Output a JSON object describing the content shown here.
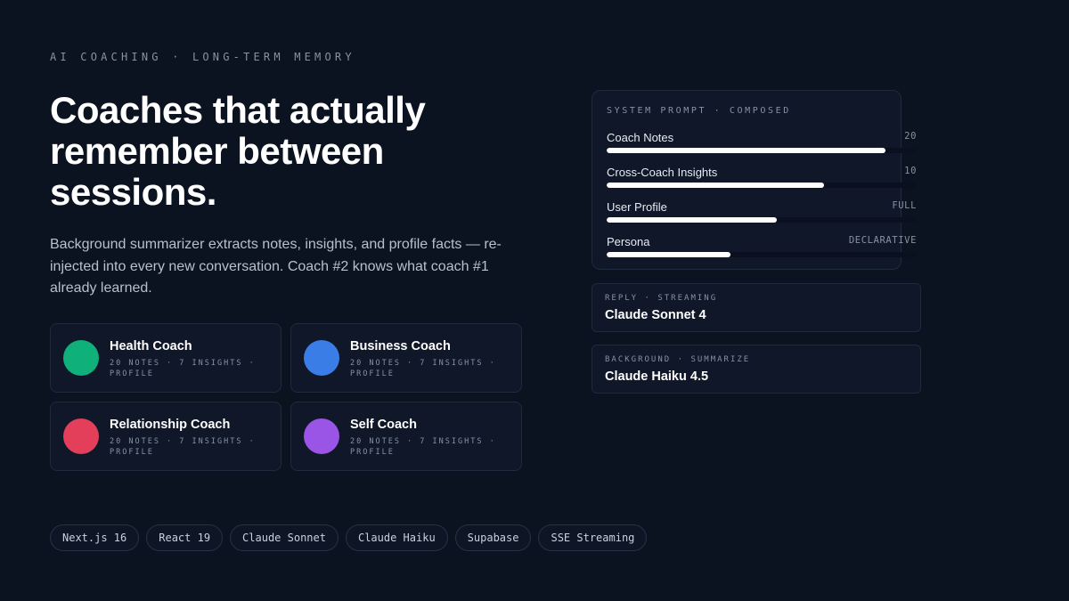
{
  "hero": {
    "eyebrow": "AI COACHING · LONG-TERM MEMORY",
    "headline": "Coaches that actually remember between sessions.",
    "subtitle": "Background summarizer extracts notes, insights, and profile facts — re-injected into every new conversation. Coach #2 knows what coach #1 already learned."
  },
  "coaches": [
    {
      "name": "Health Coach",
      "meta_line1": "20 NOTES · 7 INSIGHTS ·",
      "meta_line2": "PROFILE",
      "color": "#10b07a"
    },
    {
      "name": "Business Coach",
      "meta_line1": "20 NOTES · 7 INSIGHTS ·",
      "meta_line2": "PROFILE",
      "color": "#3b7de6"
    },
    {
      "name": "Relationship Coach",
      "meta_line1": "20 NOTES · 7 INSIGHTS ·",
      "meta_line2": "PROFILE",
      "color": "#e33e5a"
    },
    {
      "name": "Self Coach",
      "meta_line1": "20 NOTES · 7 INSIGHTS ·",
      "meta_line2": "PROFILE",
      "color": "#9b55e6"
    }
  ],
  "system_prompt": {
    "label": "SYSTEM PROMPT · COMPOSED",
    "rows": [
      {
        "label": "Coach Notes",
        "value": "20",
        "fill": 0.9
      },
      {
        "label": "Cross-Coach Insights",
        "value": "10",
        "fill": 0.7
      },
      {
        "label": "User Profile",
        "value": "FULL",
        "fill": 0.55
      },
      {
        "label": "Persona",
        "value": "DECLARATIVE",
        "fill": 0.4
      }
    ]
  },
  "models": [
    {
      "label": "REPLY · STREAMING",
      "name": "Claude Sonnet 4"
    },
    {
      "label": "BACKGROUND · SUMMARIZE",
      "name": "Claude Haiku 4.5"
    }
  ],
  "stack": [
    "Next.js 16",
    "React 19",
    "Claude Sonnet",
    "Claude Haiku",
    "Supabase",
    "SSE Streaming"
  ]
}
